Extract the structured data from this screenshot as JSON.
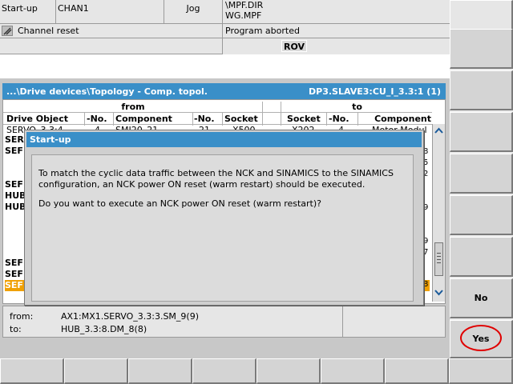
{
  "header": {
    "mode_area": "Start-up",
    "channel": "CHAN1",
    "op_mode": "Jog",
    "path_line1": "\\MPF.DIR",
    "path_line2": "WG.MPF",
    "channel_status": "Channel reset",
    "program_status": "Program aborted",
    "rov": "ROV"
  },
  "window": {
    "path": "...\\Drive devices\\Topology - Comp. topol.",
    "device": "DP3.SLAVE3:CU_I_3.3:1 (1)",
    "from_label": "from",
    "to_label": "to",
    "columns": [
      "Drive Object",
      "-No.",
      "Component",
      "-No.",
      "Socket",
      "Socket",
      "-No.",
      "Component"
    ],
    "row1_cells": [
      "SERVO_3.3:4",
      "4",
      "SMI20_21",
      "21",
      "X500",
      "X202",
      "4",
      "Motor Modul"
    ],
    "rows_left": [
      "SER",
      "SEF",
      "SEF",
      "HUB",
      "HUB",
      "SEF",
      "SEF",
      "SEF"
    ],
    "right_fragments": [
      "8",
      "5",
      "2",
      "9",
      "9",
      "7",
      "8"
    ],
    "from_label_bottom": "from:",
    "from_value": "AX1:MX1.SERVO_3.3:3.SM_9(9)",
    "to_label_bottom": "to:",
    "to_value": "HUB_3.3:8.DM_8(8)"
  },
  "dialog": {
    "title": "Start-up",
    "message1": "To match the cyclic data traffic between the NCK and SINAMICS to the SINAMICS configuration, an NCK power ON reset (warm restart) should be executed.",
    "message2": "Do you want to execute an NCK power ON reset (warm restart)?"
  },
  "softkeys": {
    "no": "No",
    "yes": "Yes"
  },
  "colors": {
    "title_blue": "#3a8fc8",
    "selected_row": "#f0a000",
    "highlight_circle": "#e00000"
  }
}
